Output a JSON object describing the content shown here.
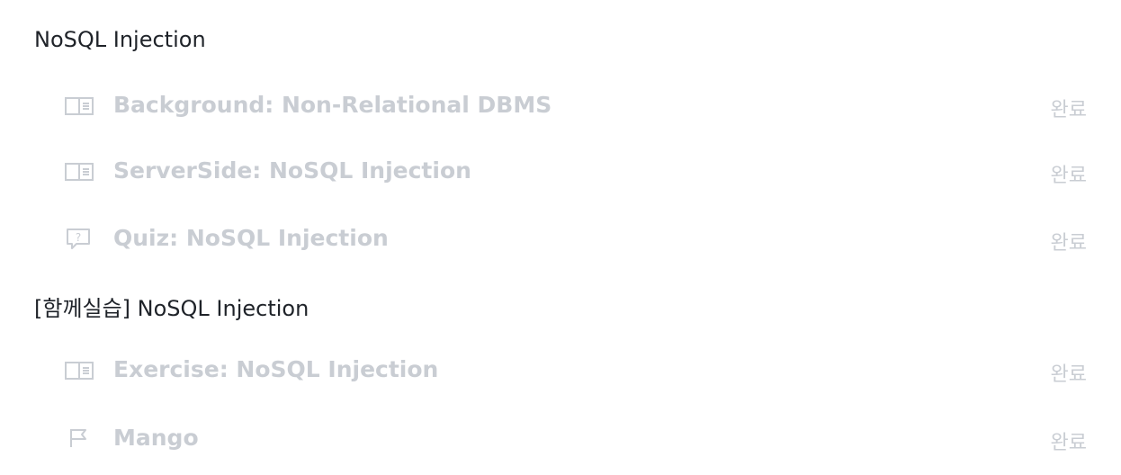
{
  "sections": [
    {
      "title": "NoSQL Injection",
      "lessons": [
        {
          "icon": "book-icon",
          "title": "Background: Non-Relational DBMS",
          "status": "완료"
        },
        {
          "icon": "book-icon",
          "title": "ServerSide: NoSQL Injection",
          "status": "완료"
        },
        {
          "icon": "quiz-icon",
          "title": "Quiz: NoSQL Injection",
          "status": "완료"
        }
      ]
    },
    {
      "title": "[함께실습] NoSQL Injection",
      "lessons": [
        {
          "icon": "book-icon",
          "title": "Exercise: NoSQL Injection",
          "status": "완료"
        },
        {
          "icon": "flag-icon",
          "title": "Mango",
          "status": "완료"
        }
      ]
    }
  ],
  "colors": {
    "section_title": "#1f2329",
    "muted": "#c9cdd3"
  }
}
